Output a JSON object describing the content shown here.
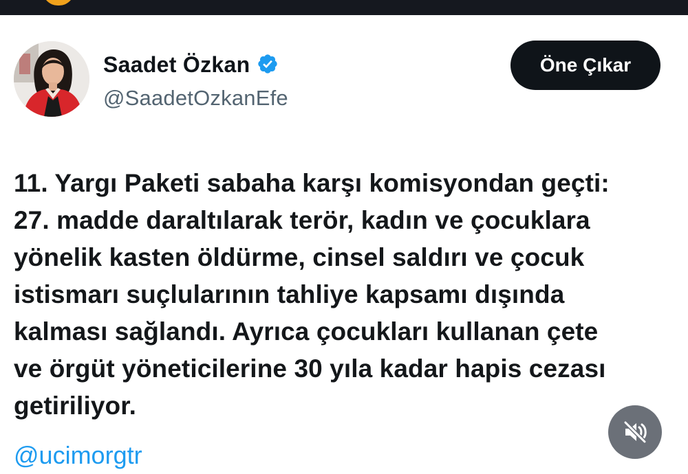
{
  "profile": {
    "display_name": "Saadet Özkan",
    "handle": "@SaadetOzkanEfe",
    "verified": true,
    "verified_color": "#1d9bf0"
  },
  "actions": {
    "feature_label": "Öne Çıkar"
  },
  "tweet": {
    "lines": [
      "11. Yargı Paketi sabaha karşı komisyondan geçti:",
      "27. madde daraltılarak terör, kadın ve çocuklara",
      "yönelik kasten öldürme, cinsel saldırı ve çocuk",
      "istismarı suçlularının tahliye kapsamı dışında",
      "kalması sağlandı. Ayrıca çocukları kullanan çete",
      "ve örgüt yöneticilerine 30 yıla kadar hapis cezası",
      "getiriliyor."
    ],
    "mention": "@ucimorgtr"
  },
  "media_controls": {
    "mute_icon": "speaker-muted-icon"
  },
  "colors": {
    "top_bar": "#15181f",
    "button_bg": "#0f1419",
    "mention": "#1d9bf0",
    "avatar_jacket": "#d8262b"
  }
}
